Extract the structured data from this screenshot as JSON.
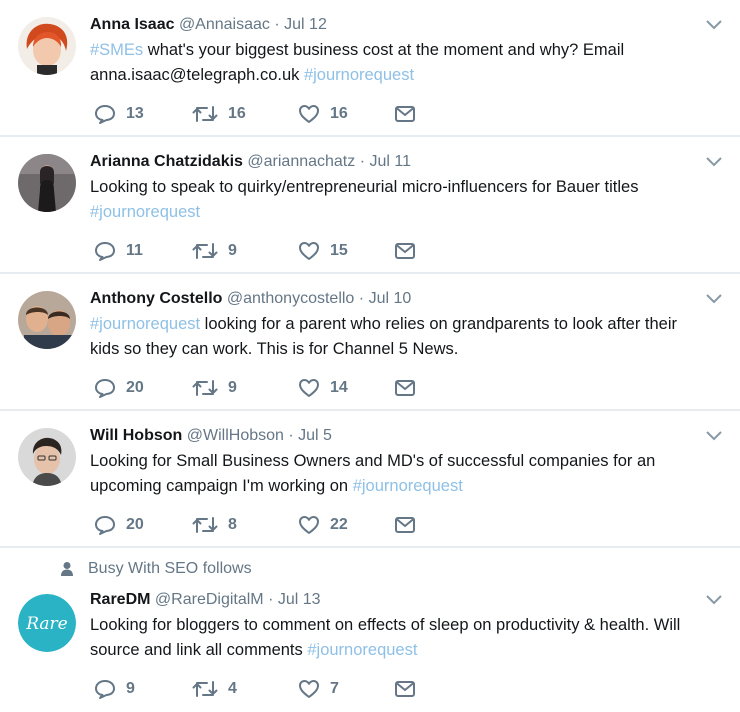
{
  "tweets": [
    {
      "name": "Anna Isaac",
      "handle": "@Annaisaac",
      "dot": "·",
      "date": "Jul 12",
      "segments": [
        {
          "text": "#SMEs",
          "tag": true
        },
        {
          "text": " what's your biggest business cost at the moment and why? Email anna.isaac@telegraph.co.uk ",
          "tag": false
        },
        {
          "text": "#journorequest",
          "tag": true
        }
      ],
      "replies": "13",
      "retweets": "16",
      "likes": "16",
      "avatar_icon": "avatar-red-hair"
    },
    {
      "name": "Arianna Chatzidakis",
      "handle": "@ariannachatz",
      "dot": "·",
      "date": "Jul 11",
      "segments": [
        {
          "text": "Looking to speak to quirky/entrepreneurial micro-influencers for Bauer titles ",
          "tag": false
        },
        {
          "text": "#journorequest",
          "tag": true
        }
      ],
      "replies": "11",
      "retweets": "9",
      "likes": "15",
      "avatar_icon": "avatar-dark-portrait"
    },
    {
      "name": "Anthony Costello",
      "handle": "@anthonycostello",
      "dot": "·",
      "date": "Jul 10",
      "segments": [
        {
          "text": "#journorequest",
          "tag": true
        },
        {
          "text": " looking for a parent who relies on grandparents to look after their kids so they can work. This is for Channel 5 News.",
          "tag": false
        }
      ],
      "replies": "20",
      "retweets": "9",
      "likes": "14",
      "avatar_icon": "avatar-two-people"
    },
    {
      "name": "Will Hobson",
      "handle": "@WillHobson",
      "dot": "·",
      "date": "Jul 5",
      "segments": [
        {
          "text": "Looking for Small Business Owners and MD's of successful companies for an upcoming campaign I'm working on ",
          "tag": false
        },
        {
          "text": "#journorequest",
          "tag": true
        }
      ],
      "replies": "20",
      "retweets": "8",
      "likes": "22",
      "avatar_icon": "avatar-man-glasses"
    },
    {
      "context": "Busy With SEO follows",
      "name": "RareDM",
      "handle": "@RareDigitalM",
      "dot": "·",
      "date": "Jul 13",
      "segments": [
        {
          "text": "Looking for bloggers to comment on effects of sleep on productivity & health. Will source and link all comments ",
          "tag": false
        },
        {
          "text": "#journorequest",
          "tag": true
        }
      ],
      "replies": "9",
      "retweets": "4",
      "likes": "7",
      "avatar_icon": "avatar-rare-logo",
      "logo_text": "Rare"
    }
  ],
  "colors": {
    "background": "#e6ecf0",
    "hashtag": "#8fc0e6",
    "secondary": "#657786",
    "rare_logo": "#2ab3c4"
  },
  "icons": [
    "reply-icon",
    "retweet-icon",
    "like-icon",
    "dm-icon",
    "chevron-down-icon",
    "person-icon"
  ]
}
